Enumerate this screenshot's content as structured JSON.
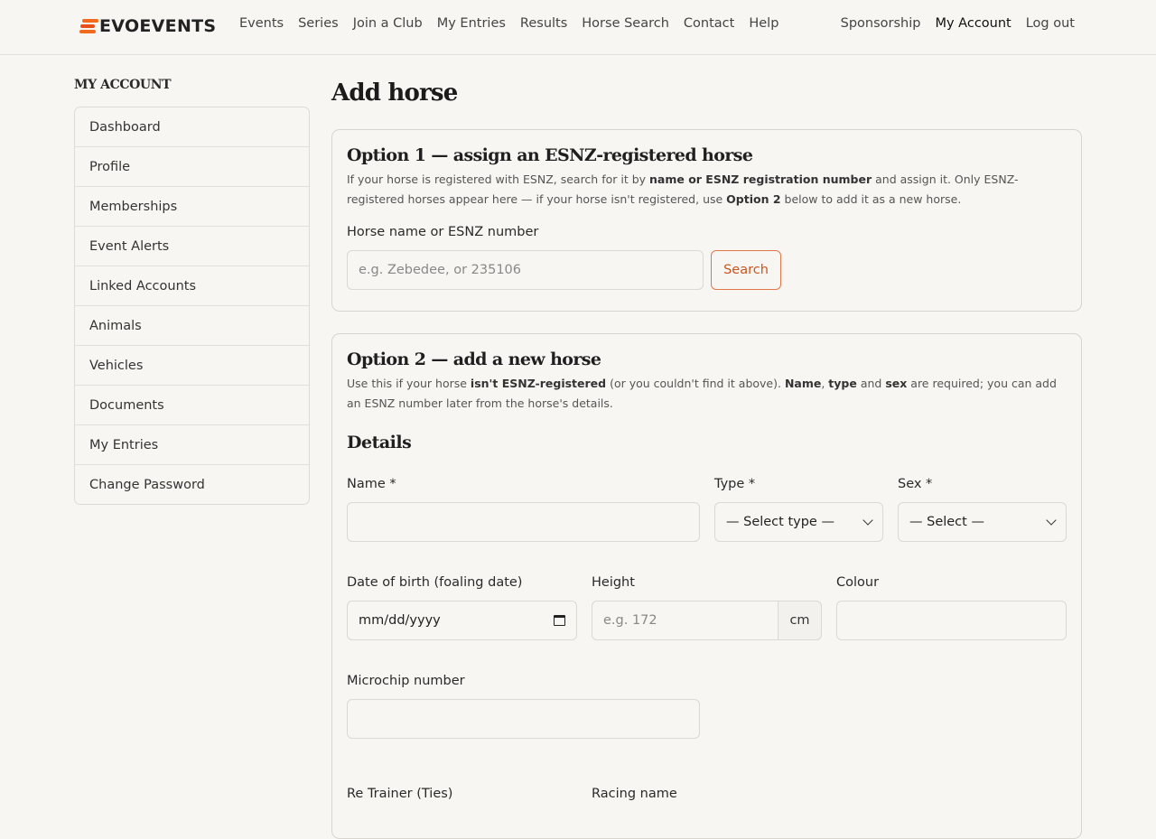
{
  "header": {
    "logo": "EVOEVENTS",
    "nav": [
      "Events",
      "Series",
      "Join a Club",
      "My Entries",
      "Results",
      "Horse Search",
      "Contact",
      "Help"
    ],
    "nav_right": [
      "Sponsorship",
      "My Account",
      "Log out"
    ],
    "active": "My Account"
  },
  "sidebar": {
    "title": "MY ACCOUNT",
    "items": [
      "Dashboard",
      "Profile",
      "Memberships",
      "Event Alerts",
      "Linked Accounts",
      "Animals",
      "Vehicles",
      "Documents",
      "My Entries",
      "Change Password"
    ]
  },
  "page": {
    "title": "Add horse"
  },
  "option1": {
    "title": "Option 1 — assign an ESNZ-registered horse",
    "desc_1": "If your horse is registered with ESNZ, search for it by ",
    "desc_b1": "name or ESNZ registration number",
    "desc_2": " and assign it. Only ESNZ-registered horses appear here — if your horse isn't registered, use ",
    "desc_b2": "Option 2",
    "desc_3": " below to add it as a new horse.",
    "search_label": "Horse name or ESNZ number",
    "search_placeholder": "e.g. Zebedee, or 235106",
    "search_button": "Search"
  },
  "option2": {
    "title": "Option 2 — add a new horse",
    "desc_1": "Use this if your horse ",
    "desc_b1": "isn't ESNZ-registered",
    "desc_2": " (or you couldn't find it above). ",
    "desc_b2": "Name",
    "desc_3": ", ",
    "desc_b3": "type",
    "desc_4": " and ",
    "desc_b4": "sex",
    "desc_5": " are required; you can add an ESNZ number later from the horse's details.",
    "details_heading": "Details",
    "name_label": "Name *",
    "type_label": "Type *",
    "type_value": "— Select type —",
    "sex_label": "Sex *",
    "sex_value": "— Select —",
    "dob_label": "Date of birth (foaling date)",
    "dob_value": "mm/dd/yyyy",
    "height_label": "Height",
    "height_placeholder": "e.g. 172",
    "height_unit": "cm",
    "colour_label": "Colour",
    "microchip_label": "Microchip number",
    "retrainer_label": "Re Trainer (Ties)",
    "racing_label": "Racing name"
  }
}
